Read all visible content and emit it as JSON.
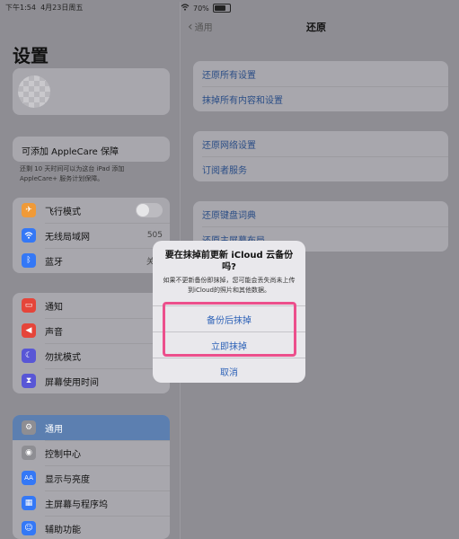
{
  "status": {
    "time": "下午1:54",
    "date": "4月23日周五",
    "battery": "70%"
  },
  "sidebar": {
    "title": "设置",
    "applecare": "可添加 AppleCare 保障",
    "applecare_note": "还剩 10 天时间可以为这台 iPad 添加 AppleCare+ 服务计划保障。",
    "group1": [
      {
        "label": "飞行模式",
        "icon": "airplane-icon",
        "color": "#f09a37"
      },
      {
        "label": "无线局域网",
        "value": "505",
        "icon": "wifi-icon",
        "color": "#3478f6"
      },
      {
        "label": "蓝牙",
        "value": "关闭",
        "icon": "bluetooth-icon",
        "color": "#3478f6"
      }
    ],
    "group2": [
      {
        "label": "通知",
        "icon": "notification-icon",
        "color": "#e5453a"
      },
      {
        "label": "声音",
        "icon": "sound-icon",
        "color": "#e5453a"
      },
      {
        "label": "勿扰模式",
        "icon": "moon-icon",
        "color": "#5856d6"
      },
      {
        "label": "屏幕使用时间",
        "icon": "hourglass-icon",
        "color": "#5856d6"
      }
    ],
    "group3": [
      {
        "label": "通用",
        "icon": "gear-icon",
        "color": "#8e8e93"
      },
      {
        "label": "控制中心",
        "icon": "toggles-icon",
        "color": "#8e8e93"
      },
      {
        "label": "显示与亮度",
        "icon": "text-size-icon",
        "color": "#3478f6"
      },
      {
        "label": "主屏幕与程序坞",
        "icon": "grid-icon",
        "color": "#3478f6"
      },
      {
        "label": "辅助功能",
        "icon": "accessibility-icon",
        "color": "#3478f6"
      }
    ]
  },
  "detail": {
    "back": "通用",
    "title": "还原",
    "group1": [
      "还原所有设置",
      "抹掉所有内容和设置"
    ],
    "group2": [
      "还原网络设置",
      "订阅者服务"
    ],
    "group3": [
      "还原键盘词典",
      "还原主屏幕布局"
    ]
  },
  "dialog": {
    "title": "要在抹掉前更新 iCloud 云备份吗?",
    "message": "如果不更新备份即抹掉，您可能会丢失尚未上传到iCloud的照片和其他数据。",
    "buttons": [
      "备份后抹掉",
      "立即抹掉",
      "取消"
    ]
  }
}
